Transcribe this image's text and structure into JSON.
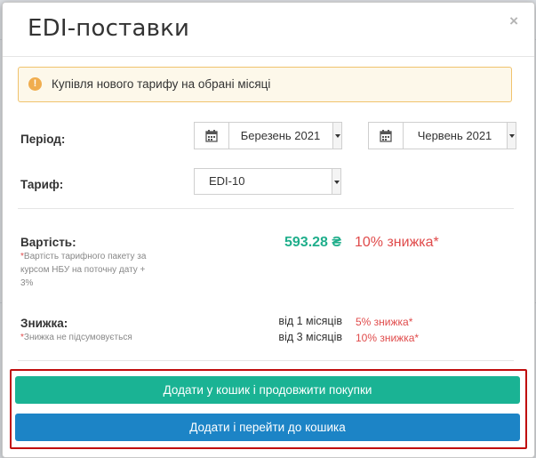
{
  "modal": {
    "title": "EDI-поставки",
    "close_glyph": "×"
  },
  "notice": {
    "icon": "exclamation-icon",
    "icon_glyph": "!",
    "text": "Купівля нового тарифу на обрані місяці",
    "color": "#f0ad4e"
  },
  "period": {
    "label": "Період:",
    "from": "Березень 2021",
    "to": "Червень 2021"
  },
  "tariff": {
    "label": "Тариф:",
    "value": "EDI-10"
  },
  "cost": {
    "label": "Вартість:",
    "note_line1": "Вартість тарифного пакету за",
    "note_line2": "курсом НБУ на поточну дату +",
    "note_line3": "3%",
    "price": "593.28 ₴",
    "discount": "10% знижка*",
    "price_color": "#1fae8b",
    "discount_color": "#e04b4b"
  },
  "discount": {
    "label": "Знижка:",
    "note": "Знижка не підсумовується",
    "tiers": [
      {
        "label": "від 1 місяців",
        "value": "5% знижка*"
      },
      {
        "label": "від 3 місяців",
        "value": "10% знижка*"
      }
    ]
  },
  "actions": {
    "add_continue": "Додати у кошик і продовжити покупки",
    "add_go_cart": "Додати і перейти до кошика",
    "green": "#1ab394",
    "blue": "#1c84c6"
  }
}
